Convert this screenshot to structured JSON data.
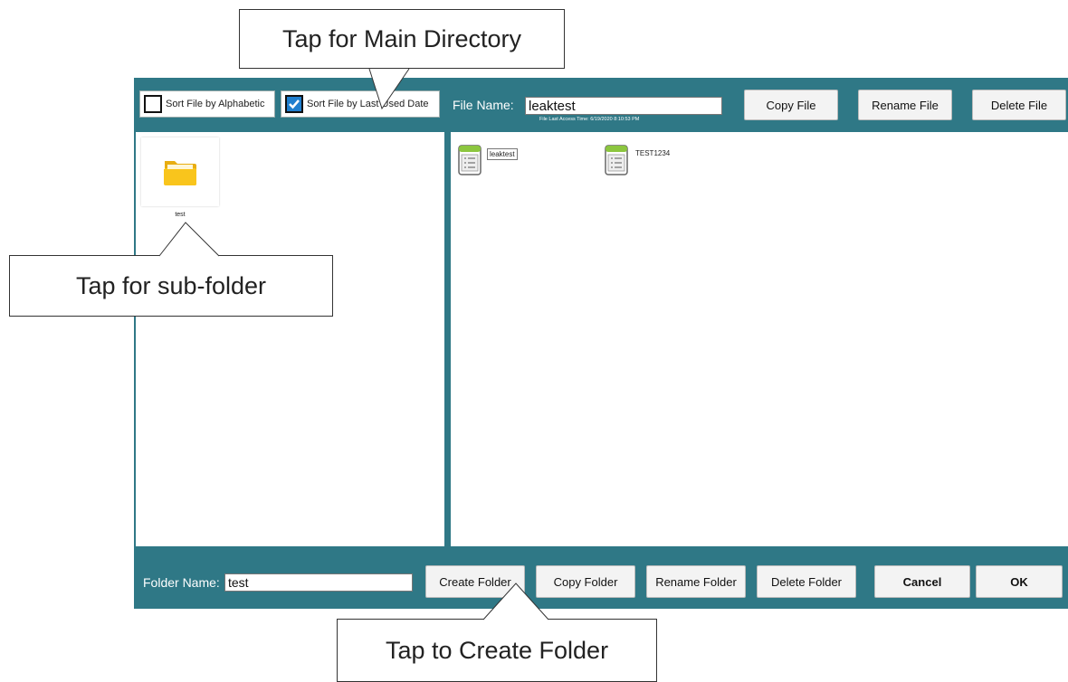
{
  "toolbar": {
    "sort_alphabetic_label": "Sort File by Alphabetic",
    "sort_alphabetic_checked": false,
    "sort_last_used_label": "Sort File by Last Used Date",
    "sort_last_used_checked": true,
    "file_name_label": "File Name:",
    "file_name_value": "leaktest",
    "file_access_time": "File Last Access Time: 6/19/2020 8:10:53 PM",
    "copy_file": "Copy File",
    "rename_file": "Rename File",
    "delete_file": "Delete File"
  },
  "folders": [
    {
      "name": "test",
      "icon": "folder-icon"
    }
  ],
  "files": [
    {
      "name": "leaktest",
      "icon": "file-list-icon",
      "selected": true
    },
    {
      "name": "TEST1234",
      "icon": "file-list-icon",
      "selected": false
    }
  ],
  "bottom": {
    "folder_name_label": "Folder Name:",
    "folder_name_value": "test",
    "create_folder": "Create Folder",
    "copy_folder": "Copy Folder",
    "rename_folder": "Rename Folder",
    "delete_folder": "Delete Folder",
    "cancel": "Cancel",
    "ok": "OK"
  },
  "callouts": {
    "main_directory": "Tap for Main Directory",
    "sub_folder": "Tap for sub-folder",
    "create_folder": "Tap to Create Folder"
  },
  "colors": {
    "app_background": "#2f7886",
    "folder_yellow": "#f9c51c",
    "file_icon_green": "#8cc63f",
    "checkbox_blue": "#1f7fcf"
  }
}
